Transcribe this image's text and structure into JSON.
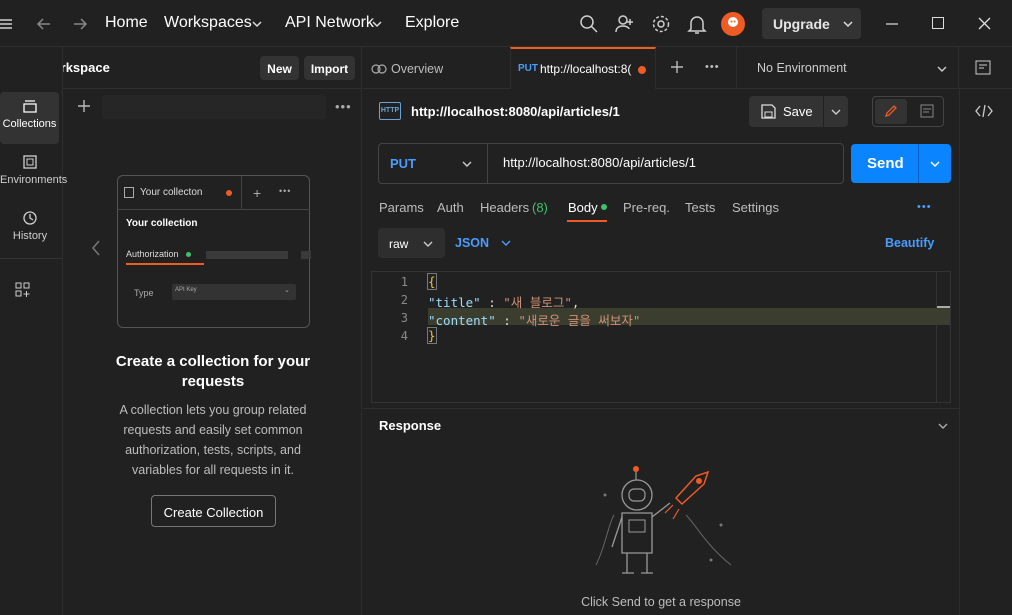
{
  "topbar": {
    "nav": [
      "Home",
      "Workspaces",
      "API Network",
      "Explore"
    ],
    "upgrade_label": "Upgrade"
  },
  "workspace": {
    "name": "My Workspace",
    "new_label": "New",
    "import_label": "Import"
  },
  "rail": [
    {
      "label": "Collections",
      "icon": "collections-icon"
    },
    {
      "label": "Environments",
      "icon": "environments-icon"
    },
    {
      "label": "History",
      "icon": "history-icon"
    }
  ],
  "empty_collections": {
    "card_tab": "Your collecton",
    "card_title": "Your collection",
    "card_auth": "Authorization",
    "card_type_label": "Type",
    "card_type_value": "API Key",
    "heading": "Create a collection for your requests",
    "description": "A collection lets you group related requests and easily set common authorization, tests, scripts, and variables for all requests in it.",
    "button": "Create Collection"
  },
  "tabs": {
    "overview": "Overview",
    "active_method": "PUT",
    "active_url": "http://localhost:8(",
    "environment": "No Environment"
  },
  "request": {
    "title": "http://localhost:8080/api/articles/1",
    "save_label": "Save",
    "method": "PUT",
    "url": "http://localhost:8080/api/articles/1",
    "send_label": "Send",
    "subtabs": {
      "params": "Params",
      "auth": "Auth",
      "headers": "Headers",
      "headers_count": "(8)",
      "body": "Body",
      "prereq": "Pre-req.",
      "tests": "Tests",
      "settings": "Settings"
    },
    "body_mode": "raw",
    "body_format": "JSON",
    "beautify": "Beautify",
    "code_lines": [
      "1",
      "2",
      "3",
      "4"
    ],
    "code": {
      "open": "{",
      "key1": "\"title\"",
      "val1": "\"새 블로그\"",
      "key2": "\"content\"",
      "val2": "\"새로운 글을 써보자\"",
      "close": "}"
    }
  },
  "response": {
    "title": "Response",
    "hint": "Click Send to get a response"
  },
  "colors": {
    "accent": "#ef5b25",
    "send": "#0a84ff",
    "green": "#3ec16b"
  }
}
